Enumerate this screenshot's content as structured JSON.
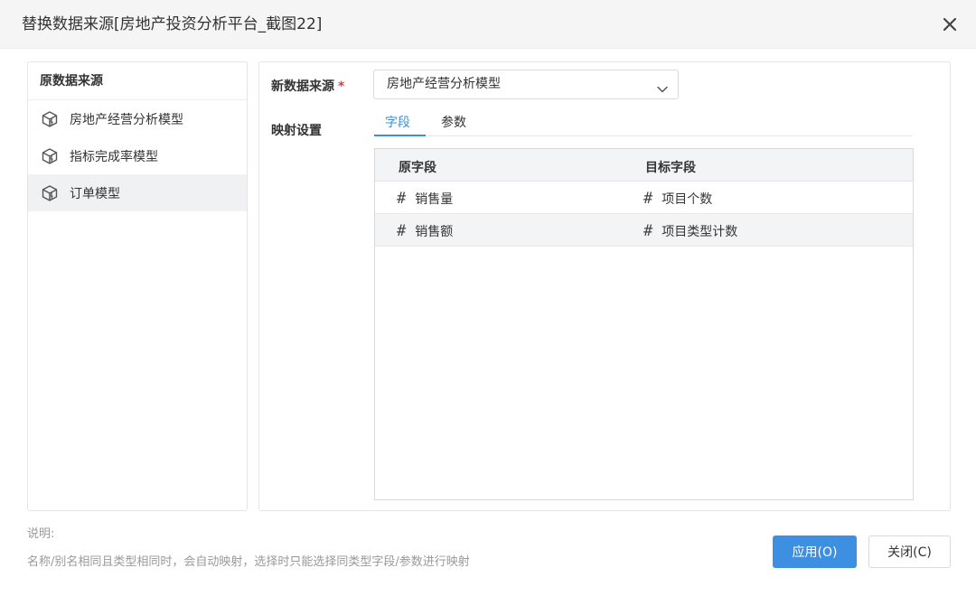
{
  "dialog": {
    "title": "替换数据来源[房地产投资分析平台_截图22]",
    "close_icon": "close-icon"
  },
  "left_panel": {
    "header": "原数据来源",
    "items": [
      {
        "label": "房地产经营分析模型",
        "icon": "cube-icon",
        "selected": false
      },
      {
        "label": "指标完成率模型",
        "icon": "cube-icon",
        "selected": false
      },
      {
        "label": "订单模型",
        "icon": "cube-icon",
        "selected": true
      }
    ]
  },
  "right_panel": {
    "new_source_label": "新数据来源",
    "required_mark": "*",
    "new_source_value": "房地产经营分析模型",
    "mapping_label": "映射设置",
    "tabs": [
      {
        "label": "字段",
        "active": true
      },
      {
        "label": "参数",
        "active": false
      }
    ],
    "table": {
      "columns": [
        "原字段",
        "目标字段"
      ],
      "rows": [
        {
          "source": "销售量",
          "target": "项目个数",
          "source_icon": "#",
          "target_icon": "#"
        },
        {
          "source": "销售额",
          "target": "项目类型计数",
          "source_icon": "#",
          "target_icon": "#"
        }
      ]
    }
  },
  "footer": {
    "note_title": "说明:",
    "note": "名称/别名相同且类型相同时，会自动映射，选择时只能选择同类型字段/参数进行映射",
    "apply_label": "应用(O)",
    "close_label": "关闭(C)"
  },
  "colors": {
    "accent": "#3d8fe1",
    "required": "#e4393c",
    "selected_bg": "#f0f1f3"
  }
}
